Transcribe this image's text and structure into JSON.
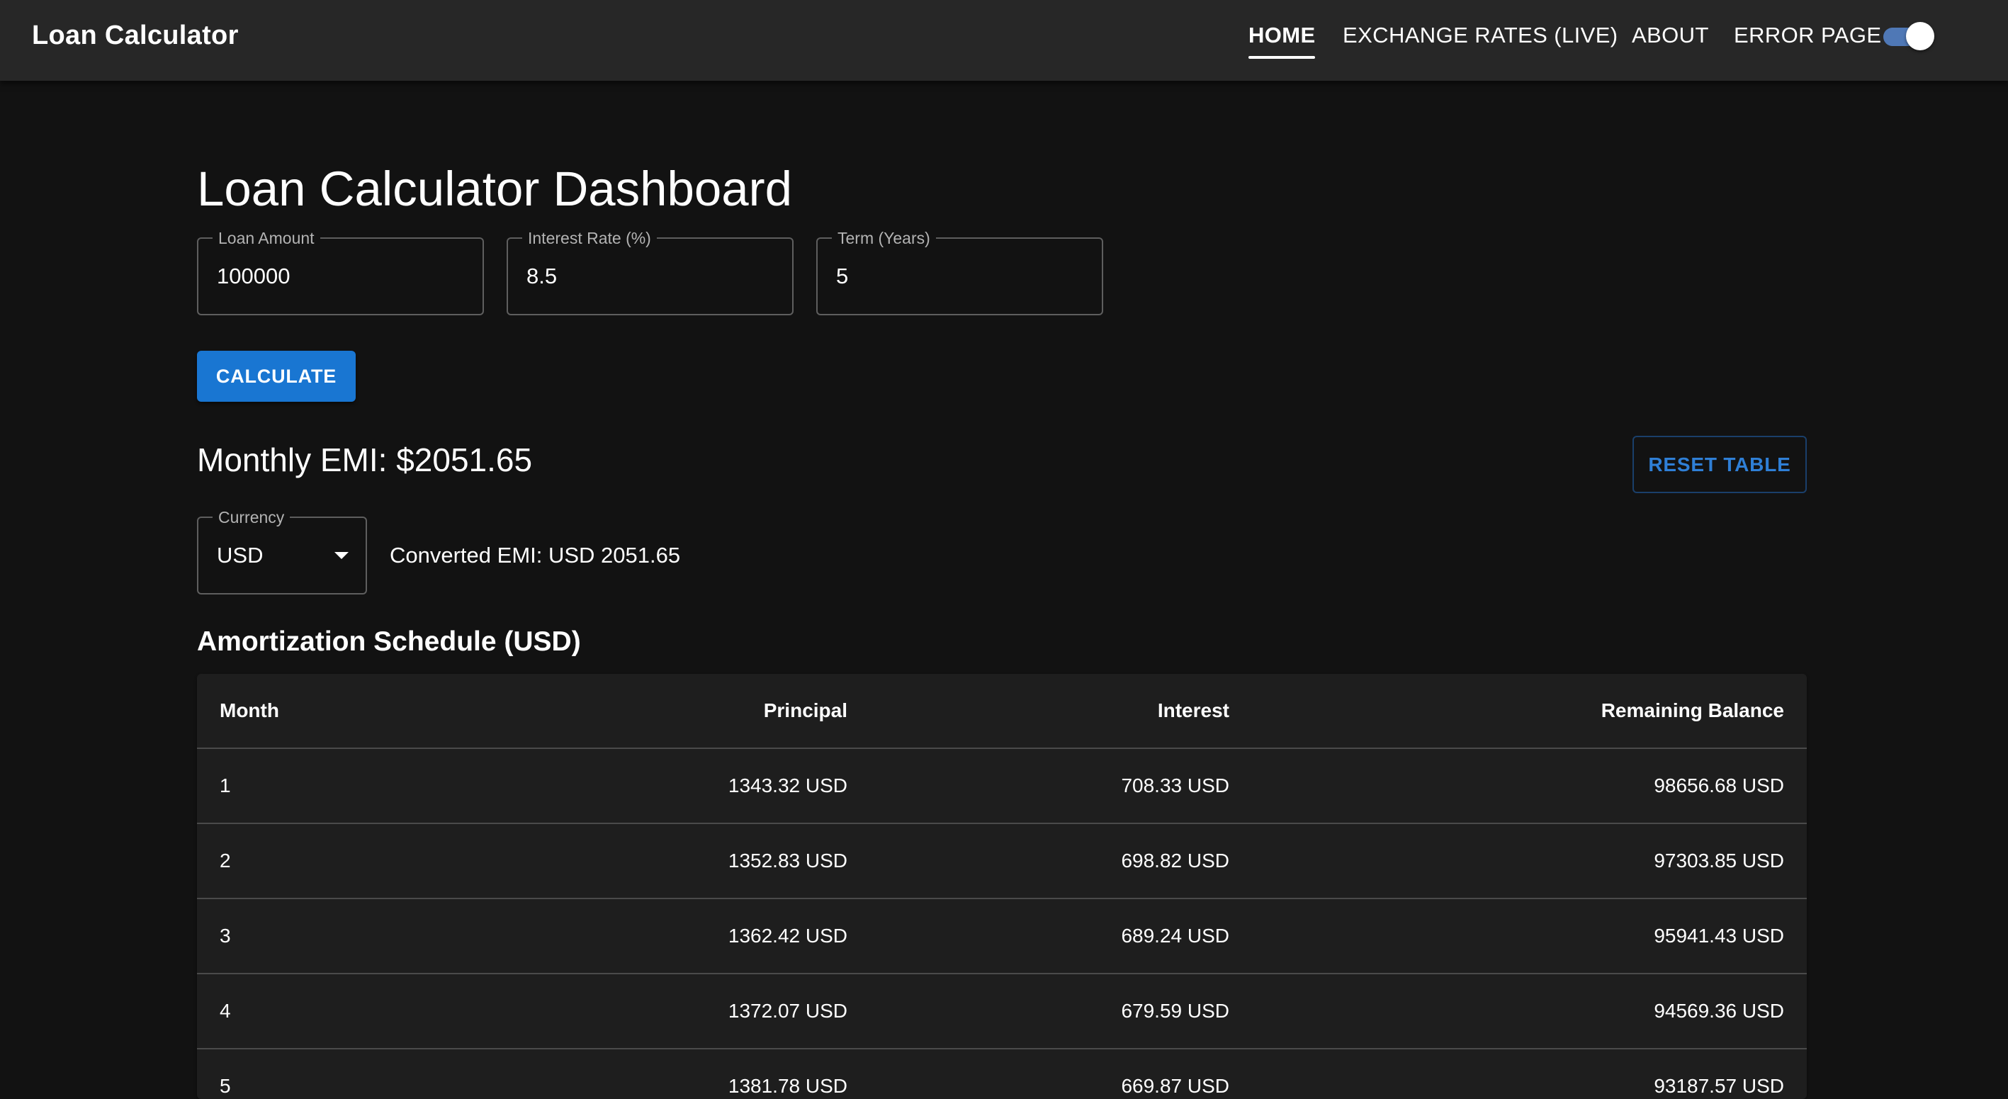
{
  "appbar": {
    "brand": "Loan Calculator",
    "nav": [
      {
        "label": "HOME",
        "active": true
      },
      {
        "label": "EXCHANGE RATES (LIVE)",
        "active": false
      },
      {
        "label": "ABOUT",
        "active": false
      },
      {
        "label": "ERROR PAGE",
        "active": false
      }
    ],
    "theme_toggle_on": true
  },
  "main": {
    "title": "Loan Calculator Dashboard",
    "fields": {
      "loan_amount": {
        "label": "Loan Amount",
        "value": "100000"
      },
      "interest_rate": {
        "label": "Interest Rate (%)",
        "value": "8.5"
      },
      "term": {
        "label": "Term (Years)",
        "value": "5"
      }
    },
    "calculate_label": "CALCULATE",
    "emi_text": "Monthly EMI: $2051.65",
    "reset_label": "RESET TABLE",
    "currency": {
      "label": "Currency",
      "value": "USD"
    },
    "converted_text": "Converted EMI: USD 2051.65",
    "schedule_title": "Amortization Schedule (USD)"
  },
  "table": {
    "headers": [
      "Month",
      "Principal",
      "Interest",
      "Remaining Balance"
    ],
    "rows": [
      [
        "1",
        "1343.32 USD",
        "708.33 USD",
        "98656.68 USD"
      ],
      [
        "2",
        "1352.83 USD",
        "698.82 USD",
        "97303.85 USD"
      ],
      [
        "3",
        "1362.42 USD",
        "689.24 USD",
        "95941.43 USD"
      ],
      [
        "4",
        "1372.07 USD",
        "679.59 USD",
        "94569.36 USD"
      ],
      [
        "5",
        "1381.78 USD",
        "669.87 USD",
        "93187.57 USD"
      ]
    ]
  },
  "colors": {
    "background": "#121212",
    "appbar": "#272727",
    "primary": "#1976d2",
    "table_bg": "#1e1e1e",
    "toggle_track": "#4f78b6"
  }
}
